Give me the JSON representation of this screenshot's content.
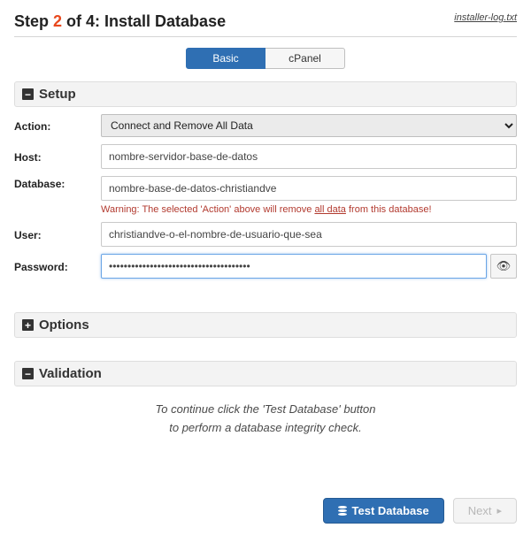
{
  "header": {
    "title_prefix": "Step ",
    "step_no": "2",
    "title_suffix": " of 4: Install Database",
    "log_link": "installer-log.txt"
  },
  "tabs": {
    "basic": "Basic",
    "cpanel": "cPanel"
  },
  "sections": {
    "setup": "Setup",
    "options": "Options",
    "validation": "Validation"
  },
  "form": {
    "action_label": "Action:",
    "action_value": "Connect and Remove All Data",
    "host_label": "Host:",
    "host_value": "nombre-servidor-base-de-datos",
    "database_label": "Database:",
    "database_value": "nombre-base-de-datos-christiandve",
    "warning_pre": "Warning: The selected 'Action' above will remove ",
    "warning_link": "all data",
    "warning_post": " from this database!",
    "user_label": "User:",
    "user_value": "christiandve-o-el-nombre-de-usuario-que-sea",
    "password_label": "Password:",
    "password_value": "••••••••••••••••••••••••••••••••••••••"
  },
  "validation_msg": {
    "line1": "To continue click the 'Test Database' button",
    "line2": "to perform a database integrity check."
  },
  "buttons": {
    "test": "Test Database",
    "next": "Next"
  }
}
